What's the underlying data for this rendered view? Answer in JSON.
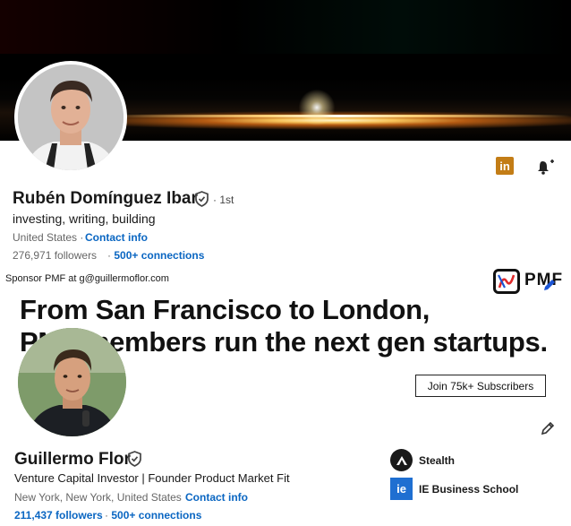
{
  "profile1": {
    "name": "Rubén Domínguez Ibar",
    "degree": "· 1st",
    "headline": "investing, writing, building",
    "location": "United States",
    "contact_sep": "·",
    "contact_label": "Contact info",
    "followers": "276,971 followers",
    "connections": "500+ connections",
    "icons": {
      "linkedin": "linkedin-icon",
      "bell": "bell-icon",
      "verified": "verified-shield-icon"
    },
    "linkedin_glyph": "in"
  },
  "sponsor": {
    "text": "Sponsor PMF at g@guillermoflor.com",
    "brand": "PMF",
    "hero_line1": "From San Francisco to London,",
    "hero_line2": "PMF members run the next gen startups.",
    "cta": "Join 75k+ Subscribers"
  },
  "profile2": {
    "name": "Guillermo Flor",
    "headline": "Venture Capital Investor | Founder Product Market Fit",
    "location": "New York, New York, United States",
    "contact_label": "Contact info",
    "followers": "211,437 followers",
    "connections": "500+ connections",
    "orgs": [
      {
        "name": "Stealth",
        "icon": "stealth-logo"
      },
      {
        "name": "IE Business School",
        "icon": "ie-logo",
        "glyph": "ie"
      }
    ]
  },
  "colors": {
    "link": "#0a66c2",
    "linkedin_premium": "#c37d16",
    "ie_blue": "#1f6fd1"
  }
}
